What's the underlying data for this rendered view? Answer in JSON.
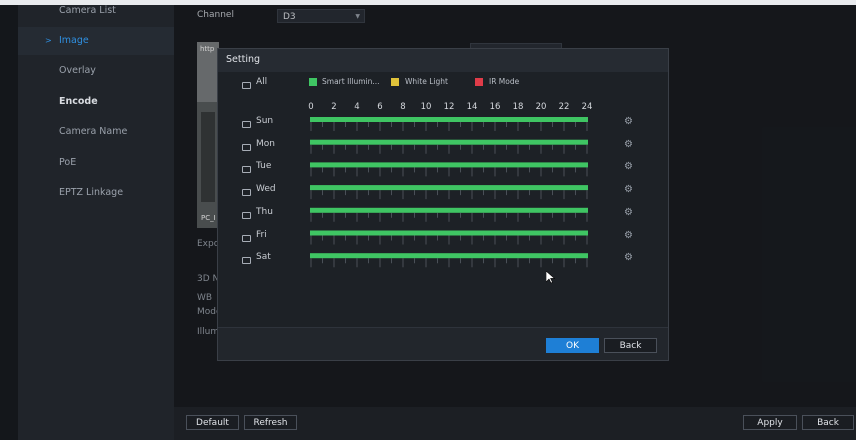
{
  "sidebar": {
    "items": [
      {
        "label": "Camera List"
      },
      {
        "label": "Image"
      },
      {
        "label": "Overlay"
      },
      {
        "label": "Encode"
      },
      {
        "label": "Camera Name"
      },
      {
        "label": "PoE"
      },
      {
        "label": "EPTZ Linkage"
      }
    ]
  },
  "main": {
    "channel_label": "Channel",
    "channel_value": "D3",
    "preview_top_text": "http",
    "preview_caption": "PC_I",
    "bg_labels": [
      "Expo",
      "3D N",
      "WB",
      "Mode",
      "Illum"
    ]
  },
  "dialog": {
    "title": "Setting",
    "all_label": "All",
    "legend": [
      {
        "label": "Smart Illumin...",
        "color": "#3fc563"
      },
      {
        "label": "White Light",
        "color": "#e0c23a"
      },
      {
        "label": "IR Mode",
        "color": "#e03c49"
      }
    ],
    "hours": [
      "0",
      "2",
      "4",
      "6",
      "8",
      "10",
      "12",
      "14",
      "16",
      "18",
      "20",
      "22",
      "24"
    ],
    "days": [
      "Sun",
      "Mon",
      "Tue",
      "Wed",
      "Thu",
      "Fri",
      "Sat"
    ],
    "schedule_fill": 1.0,
    "bar_color": "#3fc563",
    "ok_label": "OK",
    "back_label": "Back"
  },
  "footer": {
    "default_label": "Default",
    "refresh_label": "Refresh",
    "apply_label": "Apply",
    "back_label": "Back"
  },
  "colors": {
    "accent": "#1e7fd6",
    "selected_text": "#2f8fe0"
  }
}
